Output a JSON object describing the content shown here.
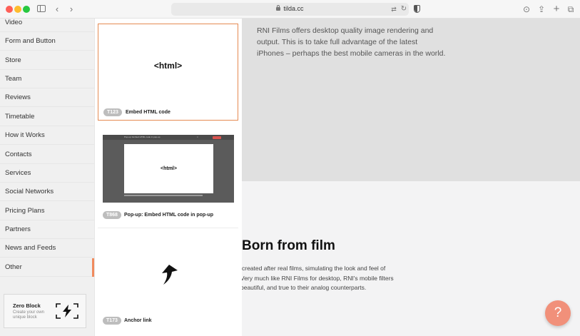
{
  "browser": {
    "url": "tilda.cc",
    "colors": {
      "close": "#fe5f57",
      "minimize": "#febc2e",
      "zoom": "#28c840"
    }
  },
  "sidebar": {
    "items": [
      {
        "label": "Video"
      },
      {
        "label": "Form and Button"
      },
      {
        "label": "Store"
      },
      {
        "label": "Team"
      },
      {
        "label": "Reviews"
      },
      {
        "label": "Timetable"
      },
      {
        "label": "How it Works"
      },
      {
        "label": "Contacts"
      },
      {
        "label": "Services"
      },
      {
        "label": "Social Networks"
      },
      {
        "label": "Pricing Plans"
      },
      {
        "label": "Partners"
      },
      {
        "label": "News and Feeds"
      },
      {
        "label": "Other"
      }
    ],
    "active": "Other",
    "accent_color": "#f08a5d",
    "zero_block": {
      "title": "Zero Block",
      "subtitle": "Create your own unique block"
    }
  },
  "blocks": [
    {
      "id": "T123",
      "title": "Embed HTML code",
      "preview_text": "<html>",
      "selected": true
    },
    {
      "id": "T868",
      "title": "Pop-up: Embed HTML code in pop-up",
      "preview_text": "<html>"
    },
    {
      "id": "T173",
      "title": "Anchor link"
    }
  ],
  "preview": {
    "intro": "RNI Films offers desktop quality image rendering and output. This is to take full advantage of the latest iPhones – perhaps the best mobile cameras in the world.",
    "heading": "Born from film",
    "body_lines": [
      "created after real films, simulating the look and feel of",
      "Very much like RNI Films for desktop, RNI's mobile filters",
      "beautiful, and true to their analog counterparts."
    ]
  },
  "help": {
    "label": "?",
    "color": "#f1907a"
  }
}
